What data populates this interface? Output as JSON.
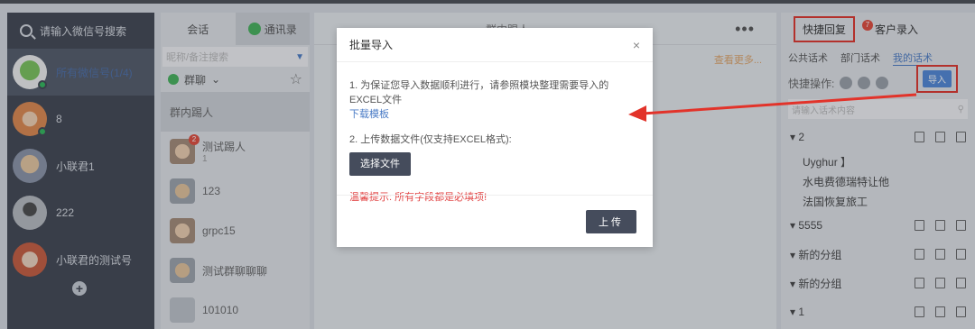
{
  "sidebar": {
    "search_placeholder": "请输入微信号搜索",
    "accounts": [
      {
        "label": "所有微信号(1/4)"
      },
      {
        "label": "8"
      },
      {
        "label": "小联君1"
      },
      {
        "label": "222"
      },
      {
        "label": "小联君的测试号"
      }
    ],
    "add_label": "+"
  },
  "contacts": {
    "tabs": [
      "会话",
      "通讯录"
    ],
    "search_placeholder": "昵称/备注搜索",
    "group_filter": "群聊",
    "items": [
      {
        "name": "群内踢人",
        "sub": ""
      },
      {
        "name": "测试踢人",
        "sub": "1"
      },
      {
        "name": "123",
        "sub": ""
      },
      {
        "name": "grpc15",
        "sub": ""
      },
      {
        "name": "测试群聊聊聊",
        "sub": ""
      },
      {
        "name": "101010",
        "sub": ""
      }
    ]
  },
  "chat": {
    "title": "群内踢人",
    "more_link": "查看更多..."
  },
  "right_panel": {
    "tabs": [
      {
        "label": "快捷回复"
      },
      {
        "label": "客户录入",
        "badge": "7"
      }
    ],
    "subtabs": [
      "公共话术",
      "部门话术",
      "我的话术"
    ],
    "ops_label": "快捷操作:",
    "import_label": "导入",
    "search_placeholder": "请输入话术内容",
    "items": [
      {
        "label": "▾ 2",
        "type": "grp",
        "actions": true
      },
      {
        "label": "Uyghur 】",
        "type": "child",
        "actions": false
      },
      {
        "label": "水电费德瑞特让他",
        "type": "child",
        "actions": false
      },
      {
        "label": "法国恢复旅工",
        "type": "child",
        "actions": false
      },
      {
        "label": "▾ 5555",
        "type": "grp",
        "actions": true
      },
      {
        "label": "▾ 新的分组",
        "type": "grp",
        "actions": true
      },
      {
        "label": "▾ 新的分组",
        "type": "grp",
        "actions": true
      },
      {
        "label": "▾ 1",
        "type": "grp",
        "actions": true
      }
    ]
  },
  "dialog": {
    "title": "批量导入",
    "close_label": "×",
    "step1": "1. 为保证您导入数据顺利进行，请参照模块整理需要导入的EXCEL文件",
    "download_link": "下载模板",
    "step2": "2. 上传数据文件(仅支持EXCEL格式):",
    "choose_button": "选择文件",
    "warning": "温馨提示: 所有字段都是必填项!",
    "upload_button": "上传"
  },
  "colors": {
    "highlight_red": "#e2332a",
    "dark_button": "#454c5c",
    "link_blue": "#4b7cc6"
  }
}
